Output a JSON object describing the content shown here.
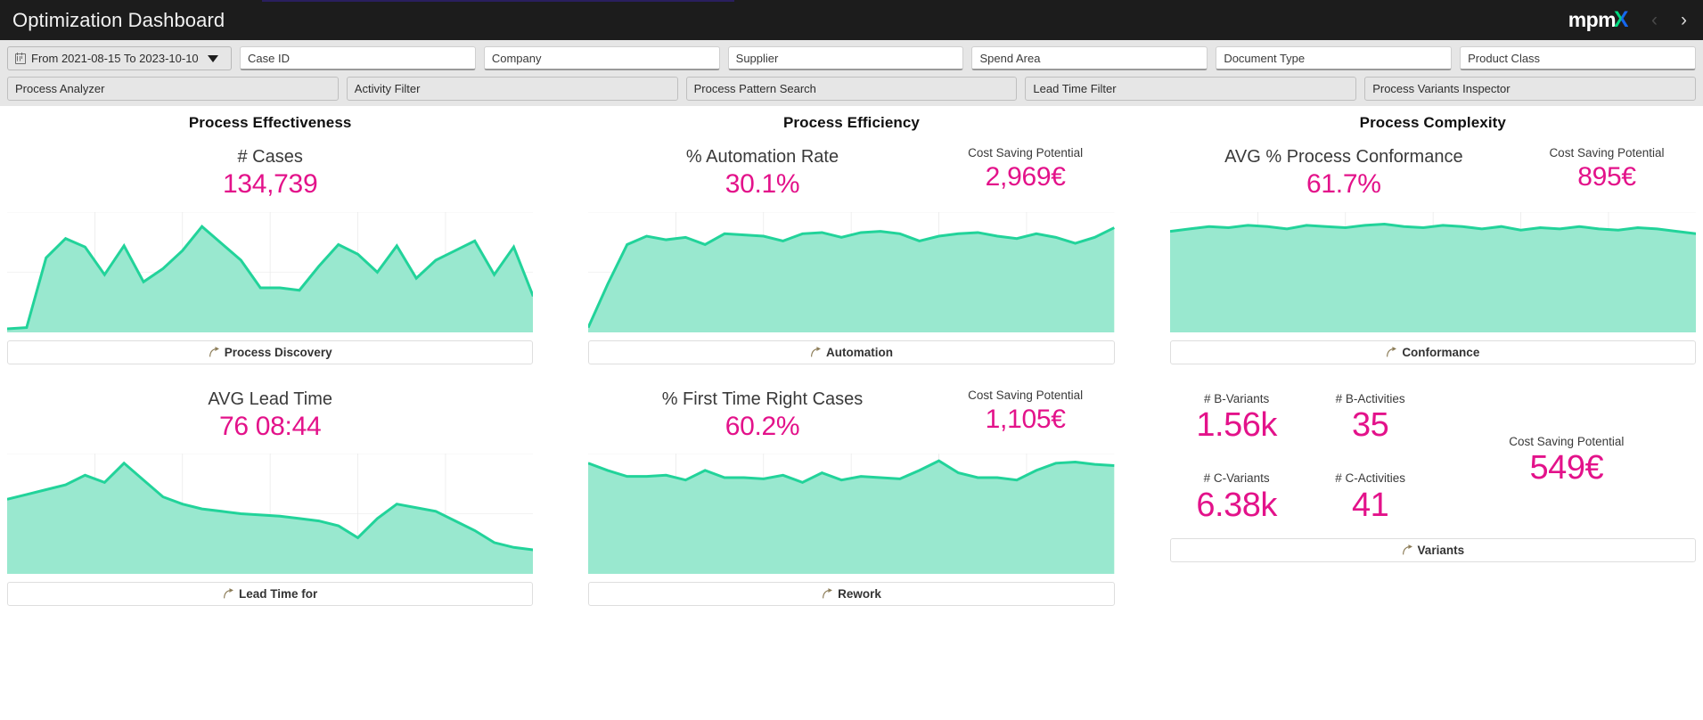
{
  "titlebar": {
    "title": "Optimization Dashboard",
    "logo_text": "mpm",
    "logo_accent": "X",
    "prev_label": "‹",
    "next_label": "›"
  },
  "filters": {
    "date_range": {
      "label": "From 2021-08-15 To 2023-10-10",
      "icon": "calendar-icon",
      "chevron": "chevron-down-icon"
    },
    "fields": [
      {
        "name": "case-id",
        "placeholder": "Case ID"
      },
      {
        "name": "company",
        "placeholder": "Company"
      },
      {
        "name": "supplier",
        "placeholder": "Supplier"
      },
      {
        "name": "spend-area",
        "placeholder": "Spend Area"
      },
      {
        "name": "document-type",
        "placeholder": "Document Type"
      },
      {
        "name": "product-class",
        "placeholder": "Product Class"
      }
    ],
    "buttons": [
      {
        "name": "process-analyzer",
        "label": "Process Analyzer"
      },
      {
        "name": "activity-filter",
        "label": "Activity Filter"
      },
      {
        "name": "process-pattern-search",
        "label": "Process Pattern Search"
      },
      {
        "name": "lead-time-filter",
        "label": "Lead Time Filter"
      },
      {
        "name": "process-variants-inspector",
        "label": "Process Variants Inspector"
      }
    ]
  },
  "colors": {
    "accent_magenta": "#e3128a",
    "chart_fill": "#99e8cf",
    "chart_stroke": "#22d39a",
    "header_bg": "#1c1c1c",
    "filter_bg": "#e6e6e6"
  },
  "columns": [
    {
      "title": "Process Effectiveness"
    },
    {
      "title": "Process Efficiency"
    },
    {
      "title": "Process Complexity"
    }
  ],
  "cards": {
    "effectiveness_top": {
      "label": "# Cases",
      "value": "134,739",
      "button": "Process Discovery"
    },
    "efficiency_top": {
      "label": "% Automation Rate",
      "value": "30.1%",
      "saving_label": "Cost Saving Potential",
      "saving_value": "2,969€",
      "button": "Automation"
    },
    "complexity_top": {
      "label": "AVG % Process Conformance",
      "value": "61.7%",
      "saving_label": "Cost Saving Potential",
      "saving_value": "895€",
      "button": "Conformance"
    },
    "effectiveness_bottom": {
      "label": "AVG Lead Time",
      "value": "76 08:44",
      "button": "Lead Time for"
    },
    "efficiency_bottom": {
      "label": "% First Time Right Cases",
      "value": "60.2%",
      "saving_label": "Cost Saving Potential",
      "saving_value": "1,105€",
      "button": "Rework"
    },
    "complexity_bottom": {
      "b_variants_label": "# B-Variants",
      "b_variants_value": "1.56k",
      "b_activities_label": "# B-Activities",
      "b_activities_value": "35",
      "c_variants_label": "# C-Variants",
      "c_variants_value": "6.38k",
      "c_activities_label": "# C-Activities",
      "c_activities_value": "41",
      "saving_label": "Cost Saving Potential",
      "saving_value": "549€",
      "button": "Variants"
    }
  },
  "chart_data": [
    {
      "id": "cases-trend",
      "type": "area",
      "title": "# Cases",
      "xlabel": "",
      "ylabel": "",
      "grid": true,
      "ylim": [
        0,
        100
      ],
      "values": [
        3,
        4,
        62,
        78,
        71,
        48,
        72,
        42,
        53,
        68,
        88,
        74,
        60,
        37,
        37,
        35,
        55,
        73,
        65,
        50,
        72,
        45,
        60,
        68,
        76,
        48,
        71,
        30
      ]
    },
    {
      "id": "automation-trend",
      "type": "area",
      "title": "% Automation Rate",
      "xlabel": "",
      "ylabel": "",
      "grid": true,
      "ylim": [
        0,
        100
      ],
      "values": [
        4,
        40,
        73,
        80,
        77,
        79,
        73,
        82,
        81,
        80,
        76,
        82,
        83,
        79,
        83,
        84,
        82,
        76,
        80,
        82,
        83,
        80,
        78,
        82,
        79,
        74,
        79,
        87
      ]
    },
    {
      "id": "conformance-trend",
      "type": "area",
      "title": "AVG % Process Conformance",
      "xlabel": "",
      "ylabel": "",
      "grid": true,
      "ylim": [
        0,
        100
      ],
      "values": [
        84,
        86,
        88,
        87,
        89,
        88,
        86,
        89,
        88,
        87,
        89,
        90,
        88,
        87,
        89,
        88,
        86,
        88,
        85,
        87,
        86,
        88,
        86,
        85,
        87,
        86,
        84,
        82
      ]
    },
    {
      "id": "lead-time-trend",
      "type": "area",
      "title": "AVG Lead Time",
      "xlabel": "",
      "ylabel": "",
      "grid": true,
      "ylim": [
        0,
        100
      ],
      "values": [
        62,
        66,
        70,
        74,
        82,
        76,
        92,
        78,
        64,
        58,
        54,
        52,
        50,
        49,
        48,
        46,
        44,
        40,
        30,
        46,
        58,
        55,
        52,
        44,
        36,
        26,
        22,
        20
      ]
    },
    {
      "id": "first-time-right-trend",
      "type": "area",
      "title": "% First Time Right Cases",
      "xlabel": "",
      "ylabel": "",
      "grid": true,
      "ylim": [
        0,
        100
      ],
      "values": [
        92,
        86,
        81,
        81,
        82,
        78,
        86,
        80,
        80,
        79,
        82,
        76,
        84,
        78,
        81,
        80,
        79,
        86,
        94,
        84,
        80,
        80,
        78,
        86,
        92,
        93,
        91,
        90
      ]
    }
  ]
}
